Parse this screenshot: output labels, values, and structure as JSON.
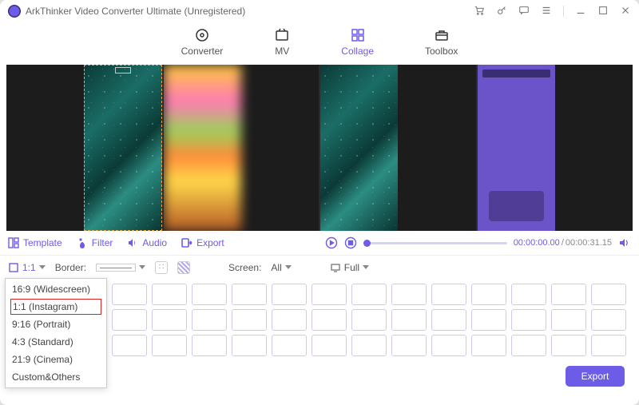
{
  "title": "ArkThinker Video Converter Ultimate (Unregistered)",
  "tabs": {
    "converter": "Converter",
    "mv": "MV",
    "collage": "Collage",
    "toolbox": "Toolbox"
  },
  "mid": {
    "template": "Template",
    "filter": "Filter",
    "audio": "Audio",
    "export": "Export",
    "time_current": "00:00:00.00",
    "time_total": "00:00:31.15"
  },
  "opt": {
    "ratio_label": "1:1",
    "border_label": "Border:",
    "screen_label": "Screen:",
    "screen_value": "All",
    "view_value": "Full"
  },
  "aspect_menu": [
    "16:9 (Widescreen)",
    "1:1 (Instagram)",
    "9:16 (Portrait)",
    "4:3 (Standard)",
    "21:9 (Cinema)",
    "Custom&Others"
  ],
  "export_btn": "Export"
}
